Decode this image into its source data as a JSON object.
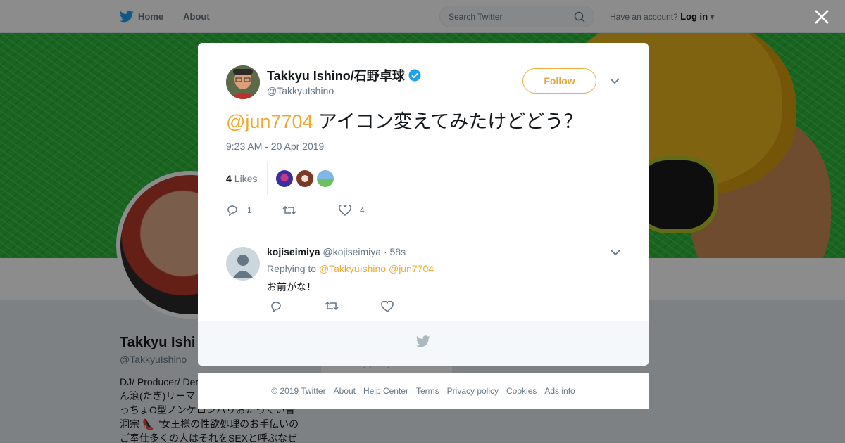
{
  "topbar": {
    "home_label": "Home",
    "about_label": "About",
    "search_placeholder": "Search Twitter",
    "account_prompt": "Have an account?",
    "login_label": "Log in"
  },
  "profile": {
    "name": "Takkyu Ishi",
    "handle": "@TakkyuIshino",
    "bio_lines": [
      "DJ/ Producer/ Der",
      "ん滾(たぎ)リーマ",
      "っちょO型ノンケロンパリおたっくい普",
      "洞宗 👠 \"女王様の性欲処理のお手伝いの",
      "ご奉仕多くの人はそれをSEXと呼ぶなぜ"
    ],
    "links_fragment": "Privacy policy · Cookies"
  },
  "tweet": {
    "author_name": "Takkyu Ishino/石野卓球",
    "author_handle": "@TakkyuIshino",
    "follow_label": "Follow",
    "mention": "@jun7704",
    "text": " アイコン変えてみたけどどう？",
    "timestamp": "9:23 AM - 20 Apr 2019",
    "likes_count": "4",
    "likes_label": "Likes",
    "reply_count": "1",
    "retweet_count": "",
    "like_count": "4",
    "liker_colors": [
      "#3b2fa0",
      "#7a3a28",
      "#6ec4c0"
    ]
  },
  "reply": {
    "name": "kojiseimiya",
    "handle": "@kojiseimiya",
    "time": "· 58s",
    "replying_prefix": "Replying to",
    "replying_mention_1": "@TakkyuIshino",
    "replying_mention_2": "@jun7704",
    "text": "お前がな！"
  },
  "footer_links": [
    "© 2019 Twitter",
    "About",
    "Help Center",
    "Terms",
    "Privacy policy",
    "Cookies",
    "Ads info"
  ],
  "colors": {
    "accent": "#f0a830",
    "twitter_blue": "#1da1f2",
    "verified": "#1da1f2"
  }
}
